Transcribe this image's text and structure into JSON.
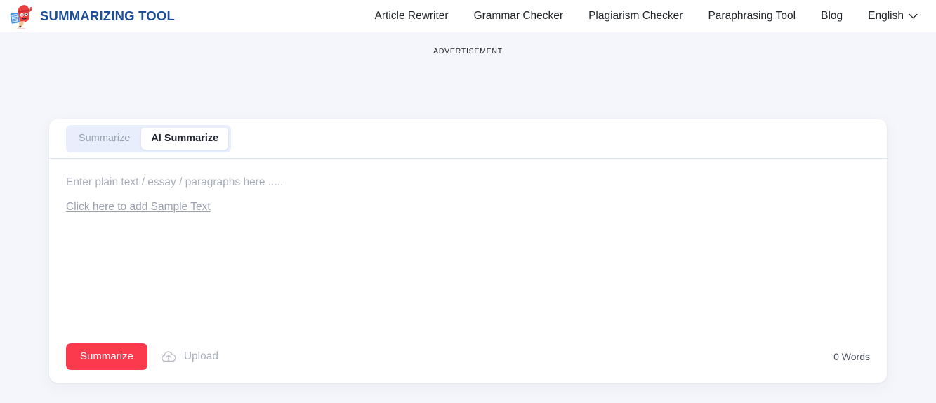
{
  "header": {
    "brand_name": "SUMMARIZING TOOL",
    "brand_color": "#1f4e99",
    "logo_icon": "pencil-mascot-icon",
    "nav": [
      {
        "label": "Article Rewriter",
        "name": "nav-article-rewriter"
      },
      {
        "label": "Grammar Checker",
        "name": "nav-grammar-checker"
      },
      {
        "label": "Plagiarism Checker",
        "name": "nav-plagiarism-checker"
      },
      {
        "label": "Paraphrasing Tool",
        "name": "nav-paraphrasing-tool"
      },
      {
        "label": "Blog",
        "name": "nav-blog"
      }
    ],
    "language": {
      "label": "English",
      "chevron_icon": "chevron-down-icon"
    }
  },
  "advertisement": {
    "label": "ADVERTISEMENT"
  },
  "tool": {
    "tabs": [
      {
        "label": "Summarize",
        "active": false
      },
      {
        "label": "AI Summarize",
        "active": true
      }
    ],
    "editor": {
      "placeholder": "Enter plain text / essay / paragraphs here .....",
      "sample_link": "Click here to add Sample Text",
      "value": ""
    },
    "footer": {
      "submit_label": "Summarize",
      "submit_color": "#fb3a4d",
      "upload_label": "Upload",
      "upload_icon": "cloud-upload-icon",
      "word_count": "0 Words"
    }
  }
}
